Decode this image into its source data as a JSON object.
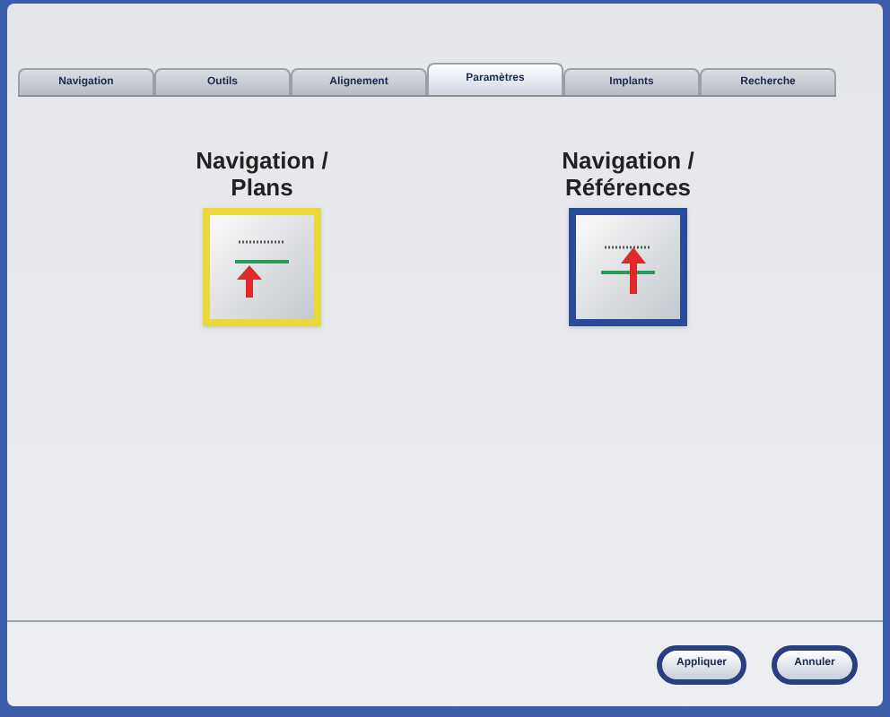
{
  "tabs": [
    {
      "label": "Navigation",
      "selected": false
    },
    {
      "label": "Outils",
      "selected": false
    },
    {
      "label": "Alignement",
      "selected": false
    },
    {
      "label": "Paramètres",
      "selected": true
    },
    {
      "label": "Implants",
      "selected": false
    },
    {
      "label": "Recherche",
      "selected": false
    }
  ],
  "options": [
    {
      "label_lines": [
        "Navigation /",
        "Plans"
      ],
      "kind": "plans",
      "color": "#e8d83a"
    },
    {
      "label_lines": [
        "Navigation /",
        "Références"
      ],
      "kind": "references",
      "color": "#2a4a9a"
    }
  ],
  "buttons": [
    "Appliquer",
    "Annuler"
  ]
}
